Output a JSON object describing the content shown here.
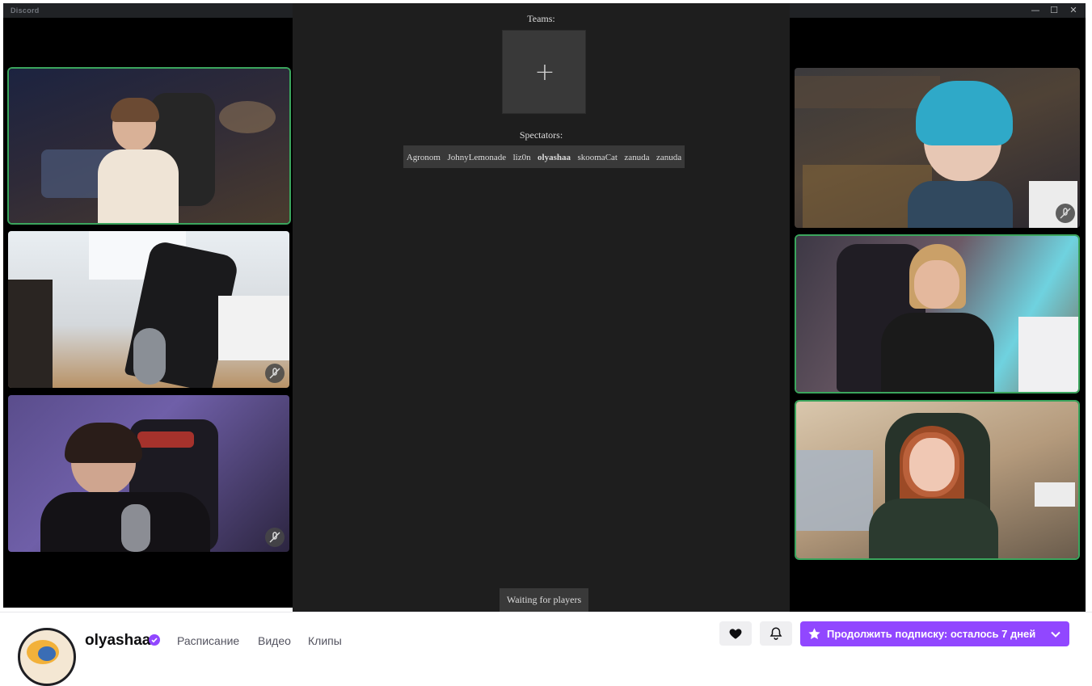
{
  "window": {
    "app_title": "Discord",
    "controls": [
      "minimize",
      "maximize",
      "close"
    ]
  },
  "game": {
    "teams_label": "Teams:",
    "add_team_symbol": "+",
    "spectators_label": "Spectators:",
    "spectators": [
      {
        "name": "Agronom",
        "bold": false
      },
      {
        "name": "JohnyLemonade",
        "bold": false
      },
      {
        "name": "liz0n",
        "bold": false
      },
      {
        "name": "olyashaa",
        "bold": true
      },
      {
        "name": "skoomaCat",
        "bold": false
      },
      {
        "name": "zanuda",
        "bold": false
      },
      {
        "name": "zanuda",
        "bold": false
      }
    ],
    "status": "Waiting for players"
  },
  "videos": {
    "left": [
      {
        "speaking": true,
        "muted": false
      },
      {
        "speaking": false,
        "muted": true
      },
      {
        "speaking": false,
        "muted": true
      }
    ],
    "right": [
      {
        "speaking": false,
        "muted": true
      },
      {
        "speaking": true,
        "muted": false
      },
      {
        "speaking": true,
        "muted": false
      }
    ]
  },
  "twitch": {
    "channel_name": "olyashaa",
    "nav": [
      "Расписание",
      "Видео",
      "Клипы"
    ],
    "subscribe_button": "Продолжить подписку: осталось 7 дней",
    "accent_color": "#9147ff",
    "speaking_color": "#3ba55d",
    "icons": [
      "heart-icon",
      "bell-icon",
      "star-icon",
      "chevron-down-icon",
      "verified-icon"
    ]
  }
}
